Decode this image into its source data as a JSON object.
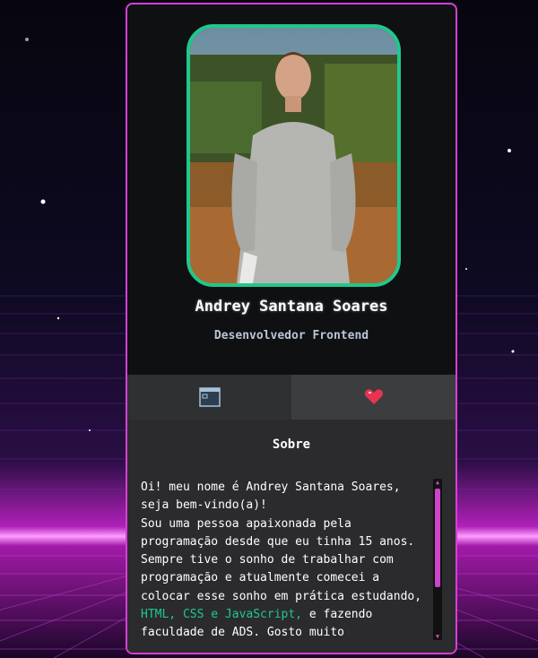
{
  "profile": {
    "name": "Andrey Santana Soares",
    "role": "Desenvolvedor Frontend"
  },
  "tabs": [
    {
      "icon": "terminal-window-icon",
      "active": true
    },
    {
      "icon": "heart-icon",
      "active": false
    }
  ],
  "about": {
    "title": "Sobre",
    "line1": "Oi! meu nome é Andrey Santana Soares, seja bem-vindo(a)!",
    "line2_before": "Sou uma pessoa apaixonada pela programação desde que eu tinha 15 anos. Sempre tive o sonho de trabalhar com programação e atualmente comecei a colocar esse sonho em prática estudando, ",
    "highlight": "HTML, CSS e JavaScript,",
    "line2_after": " e fazendo faculdade de ADS. Gosto muito"
  },
  "colors": {
    "accent": "#1fc88d",
    "border": "#d63fd6",
    "scrollbar": "#cc44cc"
  }
}
